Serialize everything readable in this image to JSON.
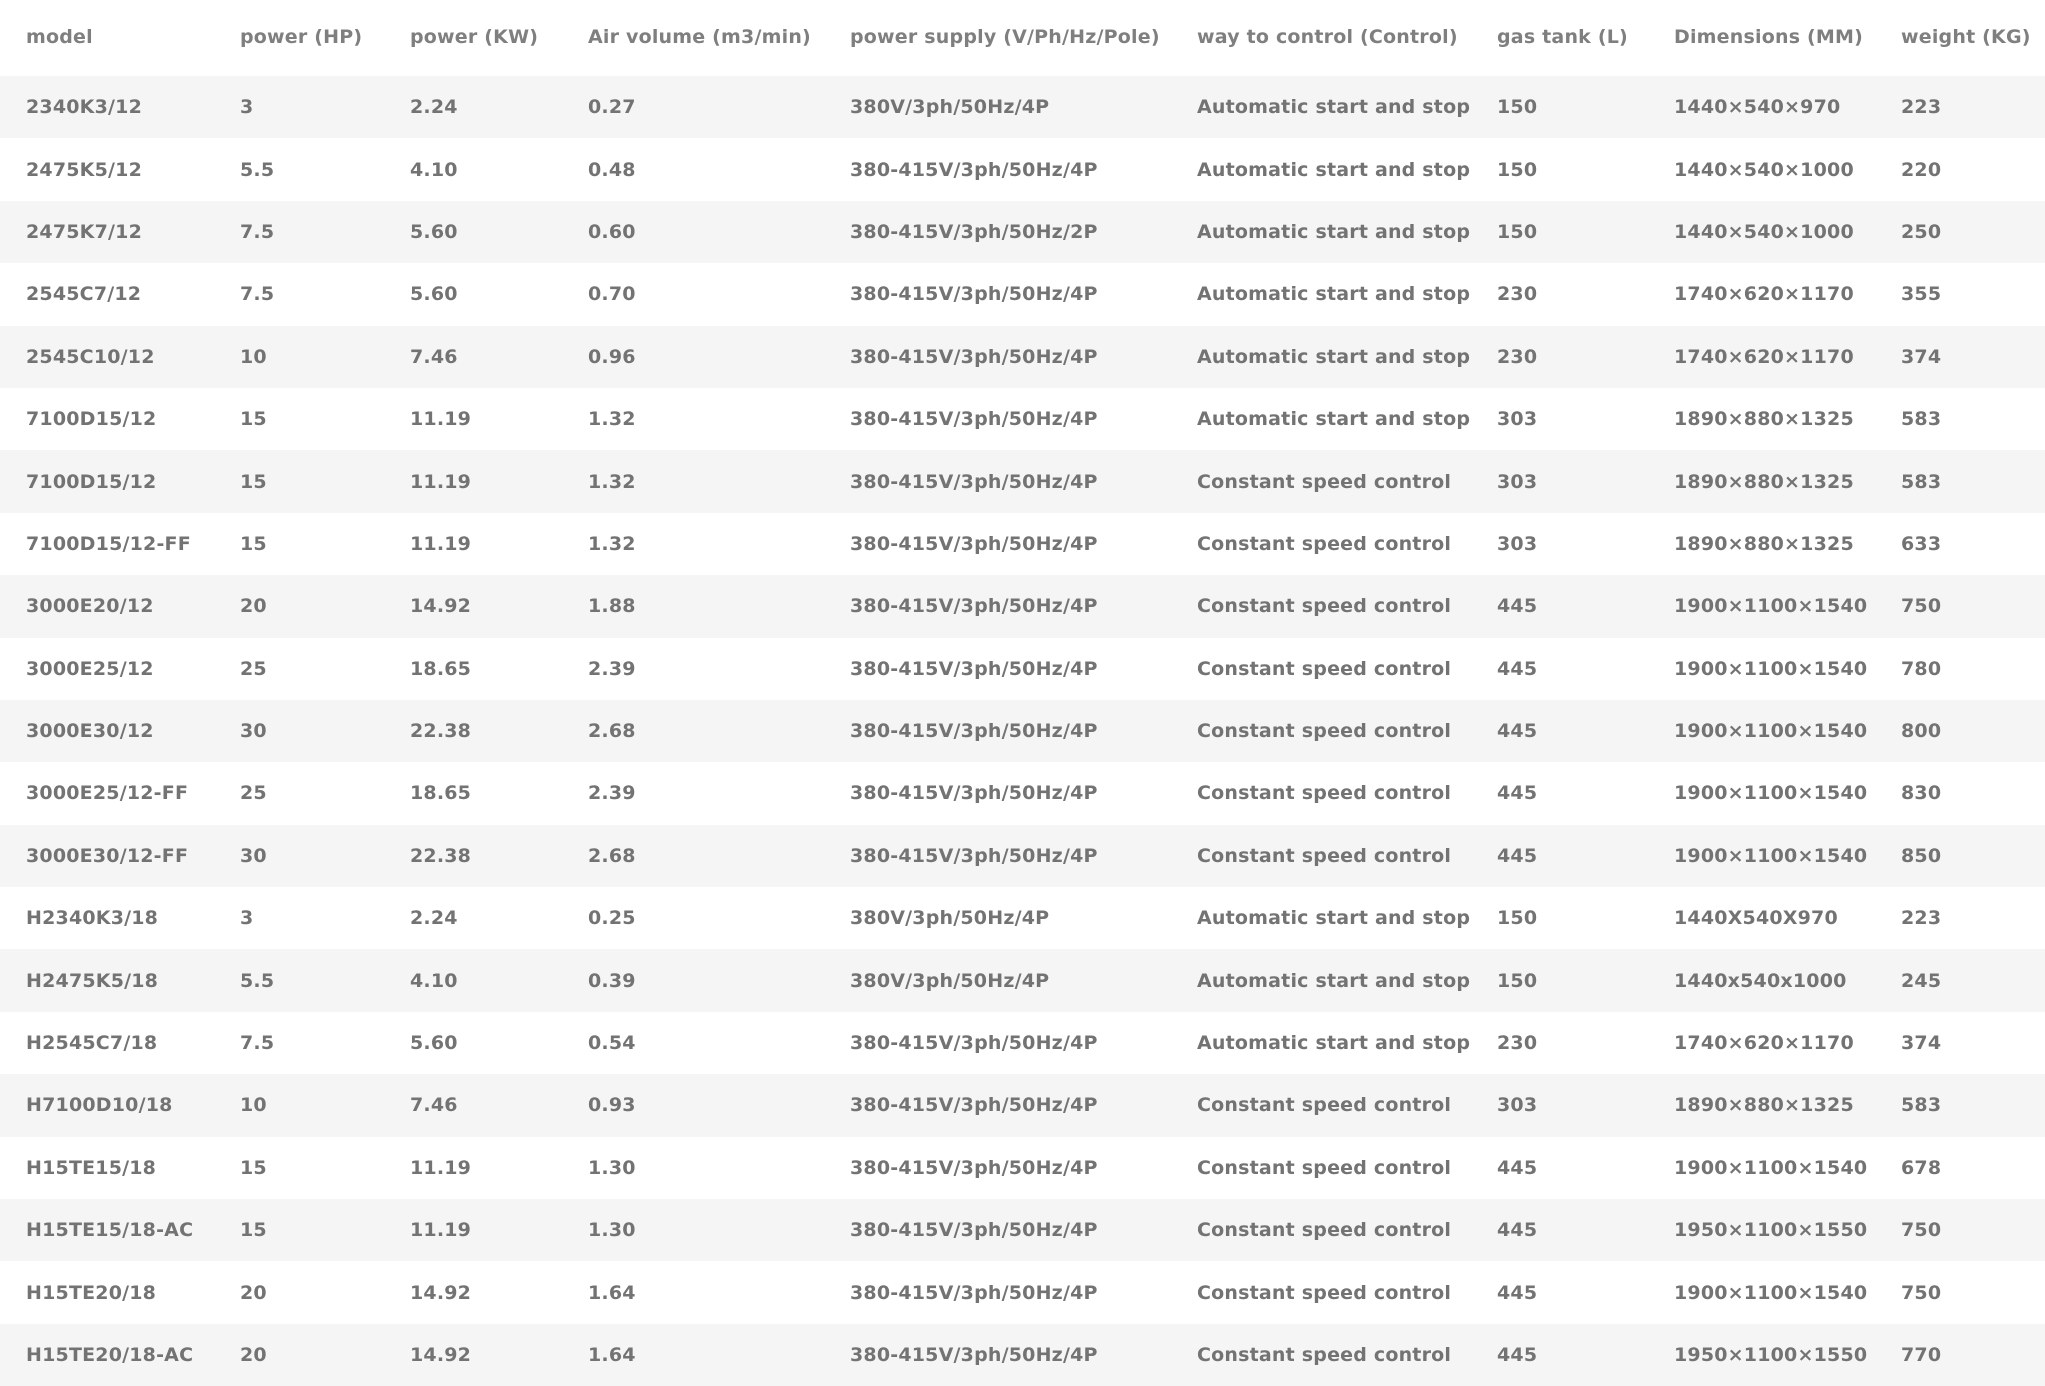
{
  "table": {
    "headers": [
      "model",
      "power (HP)",
      "power (KW)",
      "Air volume (m3/min)",
      "power supply (V/Ph/Hz/Pole)",
      "way to control (Control)",
      "gas tank (L)",
      "Dimensions (MM)",
      "weight (KG)"
    ],
    "rows": [
      [
        "2340K3/12",
        "3",
        "2.24",
        "0.27",
        "380V/3ph/50Hz/4P",
        "Automatic start and stop",
        "150",
        "1440×540×970",
        "223"
      ],
      [
        "2475K5/12",
        "5.5",
        "4.10",
        "0.48",
        "380-415V/3ph/50Hz/4P",
        "Automatic start and stop",
        "150",
        "1440×540×1000",
        "220"
      ],
      [
        "2475K7/12",
        "7.5",
        "5.60",
        "0.60",
        "380-415V/3ph/50Hz/2P",
        "Automatic start and stop",
        "150",
        "1440×540×1000",
        "250"
      ],
      [
        "2545C7/12",
        "7.5",
        "5.60",
        "0.70",
        "380-415V/3ph/50Hz/4P",
        "Automatic start and stop",
        "230",
        "1740×620×1170",
        "355"
      ],
      [
        "2545C10/12",
        "10",
        "7.46",
        "0.96",
        "380-415V/3ph/50Hz/4P",
        "Automatic start and stop",
        "230",
        "1740×620×1170",
        "374"
      ],
      [
        "7100D15/12",
        "15",
        "11.19",
        "1.32",
        "380-415V/3ph/50Hz/4P",
        "Automatic start and stop",
        "303",
        "1890×880×1325",
        "583"
      ],
      [
        "7100D15/12",
        "15",
        "11.19",
        "1.32",
        "380-415V/3ph/50Hz/4P",
        "Constant speed control",
        "303",
        "1890×880×1325",
        "583"
      ],
      [
        "7100D15/12-FF",
        "15",
        "11.19",
        "1.32",
        "380-415V/3ph/50Hz/4P",
        "Constant speed control",
        "303",
        "1890×880×1325",
        "633"
      ],
      [
        "3000E20/12",
        "20",
        "14.92",
        "1.88",
        "380-415V/3ph/50Hz/4P",
        "Constant speed control",
        "445",
        "1900×1100×1540",
        "750"
      ],
      [
        "3000E25/12",
        "25",
        "18.65",
        "2.39",
        "380-415V/3ph/50Hz/4P",
        "Constant speed control",
        "445",
        "1900×1100×1540",
        "780"
      ],
      [
        "3000E30/12",
        "30",
        "22.38",
        "2.68",
        "380-415V/3ph/50Hz/4P",
        "Constant speed control",
        "445",
        "1900×1100×1540",
        "800"
      ],
      [
        "3000E25/12-FF",
        "25",
        "18.65",
        "2.39",
        "380-415V/3ph/50Hz/4P",
        "Constant speed control",
        "445",
        "1900×1100×1540",
        "830"
      ],
      [
        "3000E30/12-FF",
        "30",
        "22.38",
        "2.68",
        "380-415V/3ph/50Hz/4P",
        "Constant speed control",
        "445",
        "1900×1100×1540",
        "850"
      ],
      [
        "H2340K3/18",
        "3",
        "2.24",
        "0.25",
        "380V/3ph/50Hz/4P",
        "Automatic start and stop",
        "150",
        "1440X540X970",
        "223"
      ],
      [
        "H2475K5/18",
        "5.5",
        "4.10",
        "0.39",
        "380V/3ph/50Hz/4P",
        "Automatic start and stop",
        "150",
        "1440x540x1000",
        "245"
      ],
      [
        "H2545C7/18",
        "7.5",
        "5.60",
        "0.54",
        "380-415V/3ph/50Hz/4P",
        "Automatic start and stop",
        "230",
        "1740×620×1170",
        "374"
      ],
      [
        "H7100D10/18",
        "10",
        "7.46",
        "0.93",
        "380-415V/3ph/50Hz/4P",
        "Constant speed control",
        "303",
        "1890×880×1325",
        "583"
      ],
      [
        "H15TE15/18",
        "15",
        "11.19",
        "1.30",
        "380-415V/3ph/50Hz/4P",
        "Constant speed control",
        "445",
        "1900×1100×1540",
        "678"
      ],
      [
        "H15TE15/18-AC",
        "15",
        "11.19",
        "1.30",
        "380-415V/3ph/50Hz/4P",
        "Constant speed control",
        "445",
        "1950×1100×1550",
        "750"
      ],
      [
        "H15TE20/18",
        "20",
        "14.92",
        "1.64",
        "380-415V/3ph/50Hz/4P",
        "Constant speed control",
        "445",
        "1900×1100×1540",
        "750"
      ],
      [
        "H15TE20/18-AC",
        "20",
        "14.92",
        "1.64",
        "380-415V/3ph/50Hz/4P",
        "Constant speed control",
        "445",
        "1950×1100×1550",
        "770"
      ]
    ]
  }
}
